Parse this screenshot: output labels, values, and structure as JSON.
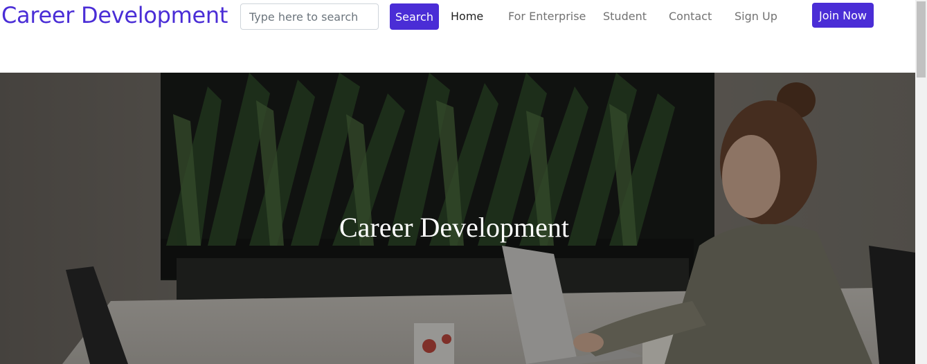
{
  "brand": {
    "name": "Career Development"
  },
  "search": {
    "placeholder": "Type here to search",
    "value": "",
    "button_label": "Search"
  },
  "nav": {
    "items": [
      {
        "label": "Home",
        "active": true
      },
      {
        "label": "For Enterprise",
        "active": false
      },
      {
        "label": "Student",
        "active": false
      },
      {
        "label": "Contact",
        "active": false
      },
      {
        "label": "Sign Up",
        "active": false
      }
    ],
    "join_label": "Join Now"
  },
  "hero": {
    "title": "Career Development",
    "image": "woman-working-on-laptop-photo"
  },
  "colors": {
    "accent": "#4a2dd6",
    "nav_text": "#727272",
    "nav_active": "#222222"
  }
}
